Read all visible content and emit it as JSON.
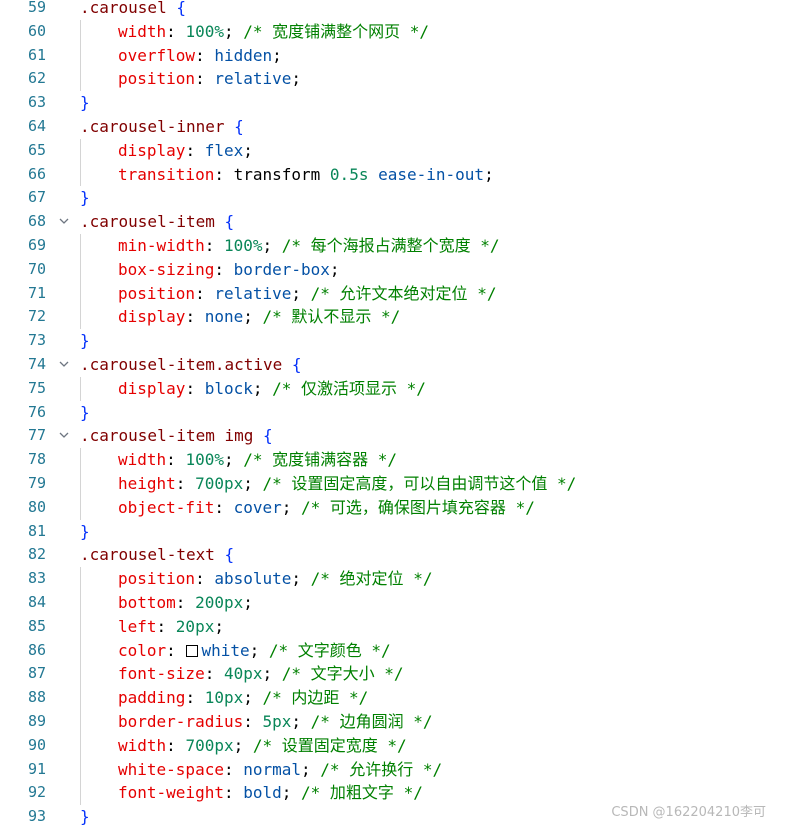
{
  "editor": {
    "lines": [
      {
        "n": "59",
        "fold": false,
        "indent": 0,
        "segs": [
          [
            "sel",
            ".carousel "
          ],
          [
            "brace",
            "{"
          ]
        ]
      },
      {
        "n": "60",
        "fold": false,
        "indent": 1,
        "segs": [
          [
            "prop",
            "width"
          ],
          [
            "txt",
            ": "
          ],
          [
            "num",
            "100%"
          ],
          [
            "txt",
            "; "
          ],
          [
            "cmt",
            "/* 宽度铺满整个网页 */"
          ]
        ]
      },
      {
        "n": "61",
        "fold": false,
        "indent": 1,
        "segs": [
          [
            "prop",
            "overflow"
          ],
          [
            "txt",
            ": "
          ],
          [
            "val",
            "hidden"
          ],
          [
            "txt",
            ";"
          ]
        ]
      },
      {
        "n": "62",
        "fold": false,
        "indent": 1,
        "segs": [
          [
            "prop",
            "position"
          ],
          [
            "txt",
            ": "
          ],
          [
            "val",
            "relative"
          ],
          [
            "txt",
            ";"
          ]
        ]
      },
      {
        "n": "63",
        "fold": false,
        "indent": 0,
        "segs": [
          [
            "brace",
            "}"
          ]
        ]
      },
      {
        "n": "64",
        "fold": false,
        "indent": 0,
        "segs": [
          [
            "sel",
            ".carousel-inner "
          ],
          [
            "brace",
            "{"
          ]
        ]
      },
      {
        "n": "65",
        "fold": false,
        "indent": 1,
        "segs": [
          [
            "prop",
            "display"
          ],
          [
            "txt",
            ": "
          ],
          [
            "val",
            "flex"
          ],
          [
            "txt",
            ";"
          ]
        ]
      },
      {
        "n": "66",
        "fold": false,
        "indent": 1,
        "segs": [
          [
            "prop",
            "transition"
          ],
          [
            "txt",
            ": transform "
          ],
          [
            "num",
            "0.5s"
          ],
          [
            "txt",
            " "
          ],
          [
            "val",
            "ease-in-out"
          ],
          [
            "txt",
            ";"
          ]
        ]
      },
      {
        "n": "67",
        "fold": false,
        "indent": 0,
        "segs": [
          [
            "brace",
            "}"
          ]
        ]
      },
      {
        "n": "68",
        "fold": true,
        "indent": 0,
        "segs": [
          [
            "sel",
            ".carousel-item "
          ],
          [
            "brace",
            "{"
          ]
        ]
      },
      {
        "n": "69",
        "fold": false,
        "indent": 1,
        "segs": [
          [
            "prop",
            "min-width"
          ],
          [
            "txt",
            ": "
          ],
          [
            "num",
            "100%"
          ],
          [
            "txt",
            "; "
          ],
          [
            "cmt",
            "/* 每个海报占满整个宽度 */"
          ]
        ]
      },
      {
        "n": "70",
        "fold": false,
        "indent": 1,
        "segs": [
          [
            "prop",
            "box-sizing"
          ],
          [
            "txt",
            ": "
          ],
          [
            "val",
            "border-box"
          ],
          [
            "txt",
            ";"
          ]
        ]
      },
      {
        "n": "71",
        "fold": false,
        "indent": 1,
        "segs": [
          [
            "prop",
            "position"
          ],
          [
            "txt",
            ": "
          ],
          [
            "val",
            "relative"
          ],
          [
            "txt",
            "; "
          ],
          [
            "cmt",
            "/* 允许文本绝对定位 */"
          ]
        ]
      },
      {
        "n": "72",
        "fold": false,
        "indent": 1,
        "segs": [
          [
            "prop",
            "display"
          ],
          [
            "txt",
            ": "
          ],
          [
            "val",
            "none"
          ],
          [
            "txt",
            "; "
          ],
          [
            "cmt",
            "/* 默认不显示 */"
          ]
        ]
      },
      {
        "n": "73",
        "fold": false,
        "indent": 0,
        "segs": [
          [
            "brace",
            "}"
          ]
        ]
      },
      {
        "n": "74",
        "fold": true,
        "indent": 0,
        "segs": [
          [
            "sel",
            ".carousel-item.active "
          ],
          [
            "brace",
            "{"
          ]
        ]
      },
      {
        "n": "75",
        "fold": false,
        "indent": 1,
        "segs": [
          [
            "prop",
            "display"
          ],
          [
            "txt",
            ": "
          ],
          [
            "val",
            "block"
          ],
          [
            "txt",
            "; "
          ],
          [
            "cmt",
            "/* 仅激活项显示 */"
          ]
        ]
      },
      {
        "n": "76",
        "fold": false,
        "indent": 0,
        "segs": [
          [
            "brace",
            "}"
          ]
        ]
      },
      {
        "n": "77",
        "fold": true,
        "indent": 0,
        "segs": [
          [
            "sel",
            ".carousel-item img "
          ],
          [
            "brace",
            "{"
          ]
        ]
      },
      {
        "n": "78",
        "fold": false,
        "indent": 1,
        "segs": [
          [
            "prop",
            "width"
          ],
          [
            "txt",
            ": "
          ],
          [
            "num",
            "100%"
          ],
          [
            "txt",
            "; "
          ],
          [
            "cmt",
            "/* 宽度铺满容器 */"
          ]
        ]
      },
      {
        "n": "79",
        "fold": false,
        "indent": 1,
        "segs": [
          [
            "prop",
            "height"
          ],
          [
            "txt",
            ": "
          ],
          [
            "num",
            "700px"
          ],
          [
            "txt",
            "; "
          ],
          [
            "cmt",
            "/* 设置固定高度，可以自由调节这个值 */"
          ]
        ]
      },
      {
        "n": "80",
        "fold": false,
        "indent": 1,
        "segs": [
          [
            "prop",
            "object-fit"
          ],
          [
            "txt",
            ": "
          ],
          [
            "val",
            "cover"
          ],
          [
            "txt",
            "; "
          ],
          [
            "cmt",
            "/* 可选，确保图片填充容器 */"
          ]
        ]
      },
      {
        "n": "81",
        "fold": false,
        "indent": 0,
        "segs": [
          [
            "brace",
            "}"
          ]
        ]
      },
      {
        "n": "82",
        "fold": false,
        "indent": 0,
        "segs": [
          [
            "sel",
            ".carousel-text "
          ],
          [
            "brace",
            "{"
          ]
        ]
      },
      {
        "n": "83",
        "fold": false,
        "indent": 1,
        "segs": [
          [
            "prop",
            "position"
          ],
          [
            "txt",
            ": "
          ],
          [
            "val",
            "absolute"
          ],
          [
            "txt",
            "; "
          ],
          [
            "cmt",
            "/* 绝对定位 */"
          ]
        ]
      },
      {
        "n": "84",
        "fold": false,
        "indent": 1,
        "segs": [
          [
            "prop",
            "bottom"
          ],
          [
            "txt",
            ": "
          ],
          [
            "num",
            "200px"
          ],
          [
            "txt",
            ";"
          ]
        ]
      },
      {
        "n": "85",
        "fold": false,
        "indent": 1,
        "segs": [
          [
            "prop",
            "left"
          ],
          [
            "txt",
            ": "
          ],
          [
            "num",
            "20px"
          ],
          [
            "txt",
            ";"
          ]
        ]
      },
      {
        "n": "86",
        "fold": false,
        "indent": 1,
        "segs": [
          [
            "prop",
            "color"
          ],
          [
            "txt",
            ": "
          ],
          [
            "swatch",
            ""
          ],
          [
            "val",
            "white"
          ],
          [
            "txt",
            "; "
          ],
          [
            "cmt",
            "/* 文字颜色 */"
          ]
        ]
      },
      {
        "n": "87",
        "fold": false,
        "indent": 1,
        "segs": [
          [
            "prop",
            "font-size"
          ],
          [
            "txt",
            ": "
          ],
          [
            "num",
            "40px"
          ],
          [
            "txt",
            "; "
          ],
          [
            "cmt",
            "/* 文字大小 */"
          ]
        ]
      },
      {
        "n": "88",
        "fold": false,
        "indent": 1,
        "segs": [
          [
            "prop",
            "padding"
          ],
          [
            "txt",
            ": "
          ],
          [
            "num",
            "10px"
          ],
          [
            "txt",
            "; "
          ],
          [
            "cmt",
            "/* 内边距 */"
          ]
        ]
      },
      {
        "n": "89",
        "fold": false,
        "indent": 1,
        "segs": [
          [
            "prop",
            "border-radius"
          ],
          [
            "txt",
            ": "
          ],
          [
            "num",
            "5px"
          ],
          [
            "txt",
            "; "
          ],
          [
            "cmt",
            "/* 边角圆润 */"
          ]
        ]
      },
      {
        "n": "90",
        "fold": false,
        "indent": 1,
        "segs": [
          [
            "prop",
            "width"
          ],
          [
            "txt",
            ": "
          ],
          [
            "num",
            "700px"
          ],
          [
            "txt",
            "; "
          ],
          [
            "cmt",
            "/* 设置固定宽度 */"
          ]
        ]
      },
      {
        "n": "91",
        "fold": false,
        "indent": 1,
        "segs": [
          [
            "prop",
            "white-space"
          ],
          [
            "txt",
            ": "
          ],
          [
            "val",
            "normal"
          ],
          [
            "txt",
            "; "
          ],
          [
            "cmt",
            "/* 允许换行 */"
          ]
        ]
      },
      {
        "n": "92",
        "fold": false,
        "indent": 1,
        "segs": [
          [
            "prop",
            "font-weight"
          ],
          [
            "txt",
            ": "
          ],
          [
            "val",
            "bold"
          ],
          [
            "txt",
            "; "
          ],
          [
            "cmt",
            "/* 加粗文字 */"
          ]
        ]
      },
      {
        "n": "93",
        "fold": false,
        "indent": 0,
        "segs": [
          [
            "brace",
            "}"
          ]
        ]
      }
    ],
    "fold_icon": "chevron-down-icon",
    "colors": {
      "selector": "#800000",
      "property": "#e50000",
      "value": "#0451a5",
      "number": "#098658",
      "comment": "#008000",
      "brace": "#0431fa",
      "line_number": "#237893"
    }
  },
  "watermark": "CSDN @162204210李可"
}
